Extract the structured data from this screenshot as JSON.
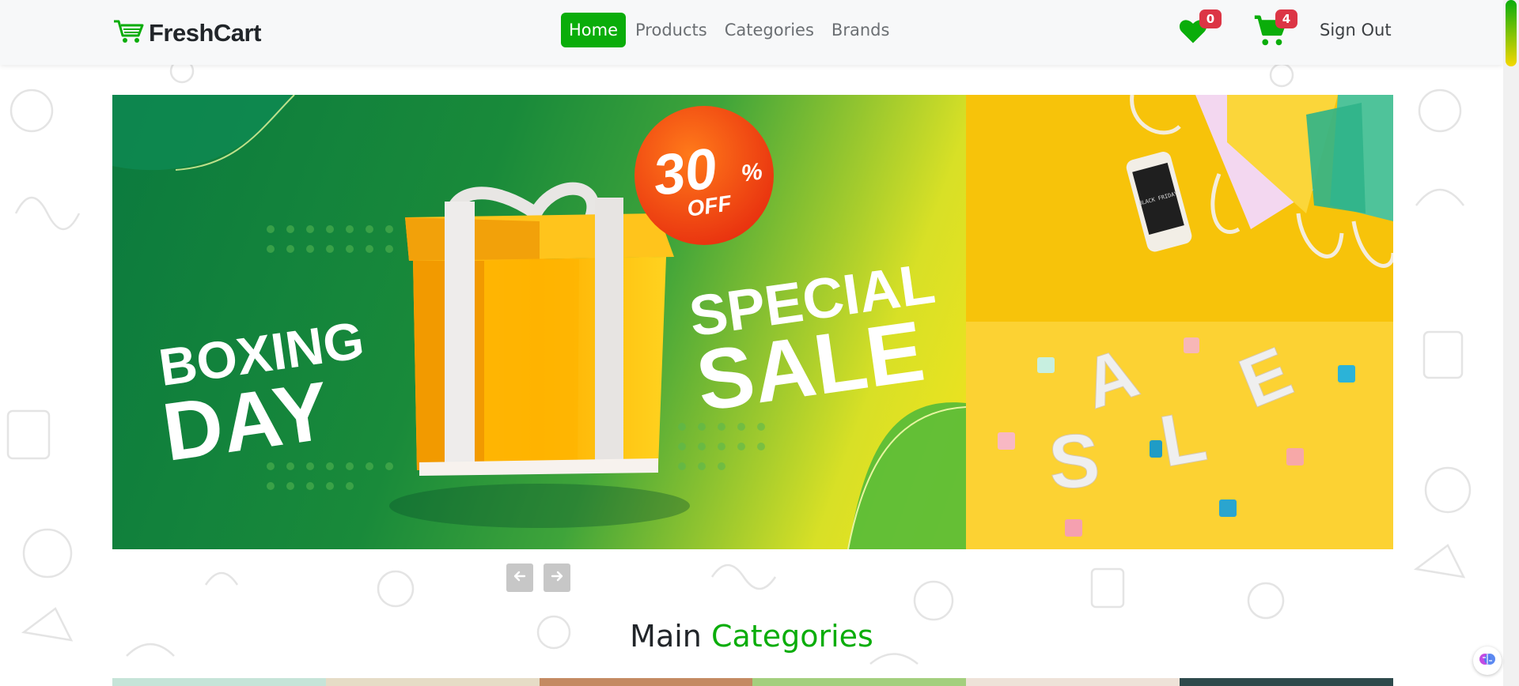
{
  "brand": {
    "name": "FreshCart",
    "color": "#0aad0a",
    "icon": "shopping-cart-icon"
  },
  "nav": {
    "links": [
      {
        "label": "Home",
        "active": true
      },
      {
        "label": "Products",
        "active": false
      },
      {
        "label": "Categories",
        "active": false
      },
      {
        "label": "Brands",
        "active": false
      }
    ],
    "wishlist": {
      "icon": "heart-icon",
      "count": "0"
    },
    "cart": {
      "icon": "cart-icon",
      "count": "4"
    },
    "signout_label": "Sign Out"
  },
  "hero": {
    "banner": {
      "line1": "BOXING",
      "line2": "DAY",
      "discount": "30",
      "discount_suffix": "%",
      "discount_off": "OFF",
      "sale1": "SPECIAL",
      "sale2": "SALE"
    },
    "side_bottom_letters": [
      "S",
      "A",
      "L",
      "E"
    ],
    "phone_screen_text": "BLACK FRIDAY",
    "prev_icon": "arrow-left-icon",
    "next_icon": "arrow-right-icon"
  },
  "section": {
    "title_plain": "Main",
    "title_accent": "Categories"
  },
  "category_strip_colors": [
    "#c6e4d8",
    "#e6dcc6",
    "#c48a62",
    "#a4cf7e",
    "#eee2d8",
    "#2e4a4c"
  ],
  "colors": {
    "accent": "#0aad0a",
    "badge": "#dc3545"
  }
}
